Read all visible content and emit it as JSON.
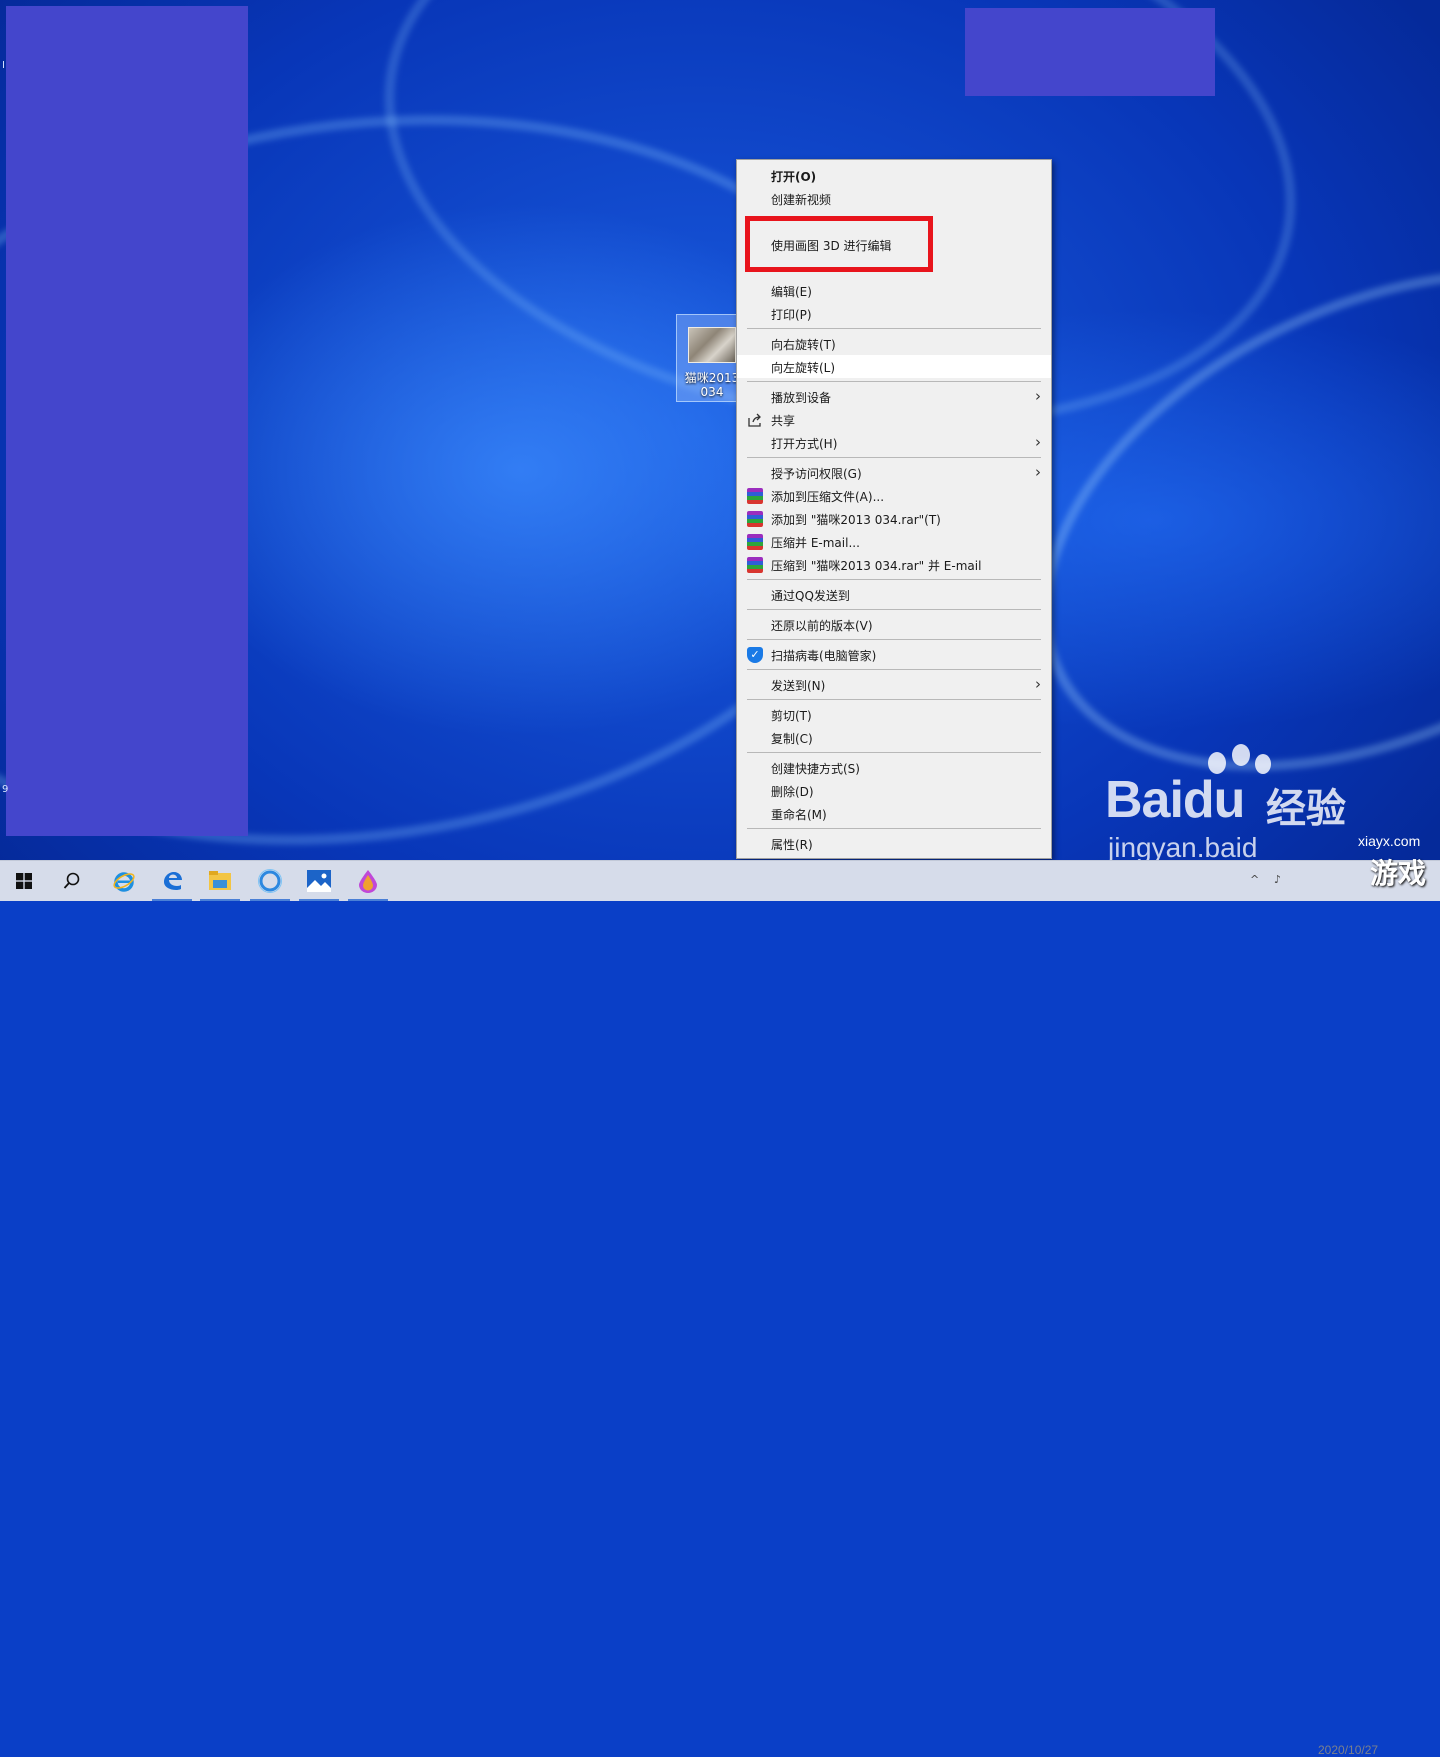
{
  "desktop": {
    "icon": {
      "label_line1": "猫咪2013",
      "label_line2": "034"
    },
    "edge_letters": [
      "I",
      "9"
    ]
  },
  "context_menu": {
    "items": [
      {
        "label": "打开(O)",
        "bold": true
      },
      {
        "label": "创建新视频"
      },
      {
        "label": "使用画图 3D 进行编辑"
      },
      {
        "label": "编辑(E)"
      },
      {
        "label": "打印(P)"
      },
      {
        "label": "向右旋转(T)"
      },
      {
        "label": "向左旋转(L)",
        "highlighted": true
      },
      {
        "label": "播放到设备",
        "submenu": true
      },
      {
        "label": "共享",
        "icon": "share-icon"
      },
      {
        "label": "打开方式(H)",
        "submenu": true
      },
      {
        "label": "授予访问权限(G)",
        "submenu": true
      },
      {
        "label": "添加到压缩文件(A)...",
        "icon": "winrar-icon"
      },
      {
        "label": "添加到 \"猫咪2013 034.rar\"(T)",
        "icon": "winrar-icon"
      },
      {
        "label": "压缩并 E-mail...",
        "icon": "winrar-icon"
      },
      {
        "label": "压缩到 \"猫咪2013 034.rar\" 并 E-mail",
        "icon": "winrar-icon"
      },
      {
        "label": "通过QQ发送到"
      },
      {
        "label": "还原以前的版本(V)"
      },
      {
        "label": "扫描病毒(电脑管家)",
        "icon": "shield-icon"
      },
      {
        "label": "发送到(N)",
        "submenu": true
      },
      {
        "label": "剪切(T)"
      },
      {
        "label": "复制(C)"
      },
      {
        "label": "创建快捷方式(S)"
      },
      {
        "label": "删除(D)"
      },
      {
        "label": "重命名(M)"
      },
      {
        "label": "属性(R)"
      }
    ],
    "highlight_box_color": "#e8141c",
    "submenu_arrow": "›"
  },
  "taskbar": {
    "apps": [
      "start-icon",
      "search-icon",
      "internet-explorer-icon",
      "edge-icon",
      "file-explorer-icon",
      "cortana-icon",
      "photos-icon",
      "paint-3d-icon"
    ],
    "tray_date": "2020/10/27"
  },
  "watermark": {
    "brand": "Bai",
    "brand_du": "du",
    "jingyan": "经验",
    "url": "jingyan.baid",
    "site": "xiayx.com",
    "game": "游戏"
  },
  "colors": {
    "desktop_blue": "#0a3fc7",
    "mask_purple": "#4446cc",
    "menu_bg": "#f0f0f0"
  }
}
